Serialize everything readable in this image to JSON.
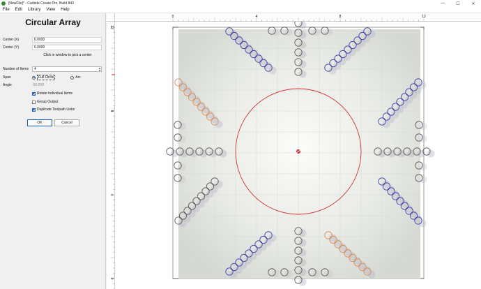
{
  "window": {
    "title": "[NewFile]* - Carbide Create Pro, Build 843",
    "minimize_glyph": "—",
    "maximize_glyph": "☐",
    "close_glyph": "✕"
  },
  "menu": [
    "File",
    "Edit",
    "Library",
    "View",
    "Help"
  ],
  "panel": {
    "title": "Circular Array",
    "center_x_label": "Center (X)",
    "center_x_value": "6.0000",
    "center_y_label": "Center (Y)",
    "center_y_value": "6.0000",
    "hint": "Click in window to pick a center",
    "num_items_label": "Number of Items",
    "num_items_value": "4",
    "span_label": "Span",
    "span_full": "Full Circle",
    "span_arc": "Arc",
    "angle_label": "Angle",
    "angle_value": "-90.000",
    "rotate_label": "Rotate Individual Items",
    "rotate_checked": true,
    "group_label": "Group Output",
    "group_checked": false,
    "duplicate_label": "Duplicate Toolpath Links",
    "duplicate_checked": true,
    "ok_label": "OK",
    "cancel_label": "Cancel"
  },
  "rulers": {
    "top_labels": [
      "0",
      "4",
      "8",
      "12"
    ],
    "left_labels": [
      "12",
      "8",
      "4",
      "0"
    ]
  },
  "colors": {
    "circle_blue": "#3a3aa8",
    "circle_orange": "#d88a50",
    "circle_gray": "#555555",
    "center_circle": "#d03030",
    "ruler_marker": "#d03030"
  }
}
